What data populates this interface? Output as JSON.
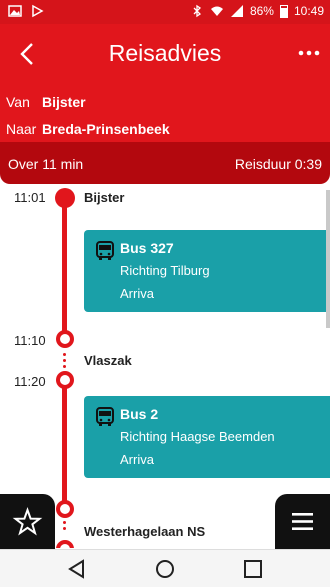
{
  "status_bar": {
    "battery": "86%",
    "time": "10:49",
    "left_icons": [
      "image-icon",
      "play-store-icon"
    ],
    "right_icons": [
      "bluetooth-icon",
      "wifi-icon",
      "signal-icon",
      "battery-icon"
    ]
  },
  "header": {
    "title": "Reisadvies"
  },
  "route": {
    "from_label": "Van",
    "from_value": "Bijster",
    "to_label": "Naar",
    "to_value": "Breda-Prinsenbeek"
  },
  "summary": {
    "departure_in": "Over 11 min",
    "duration": "Reisduur 0:39"
  },
  "stops": [
    {
      "time": "11:01",
      "name": "Bijster"
    },
    {
      "time": "11:10",
      "name": "Vlaszak"
    },
    {
      "time": "11:20",
      "name": ""
    },
    {
      "time": "",
      "name": "Westerhagelaan NS"
    }
  ],
  "legs": [
    {
      "service": "Bus 327",
      "direction": "Richting Tilburg",
      "operator": "Arriva"
    },
    {
      "service": "Bus 2",
      "direction": "Richting Haagse Beemden",
      "operator": "Arriva"
    }
  ],
  "colors": {
    "primary": "#e1161c",
    "summary_bar": "#b3080e",
    "card": "#1aa0a8"
  }
}
